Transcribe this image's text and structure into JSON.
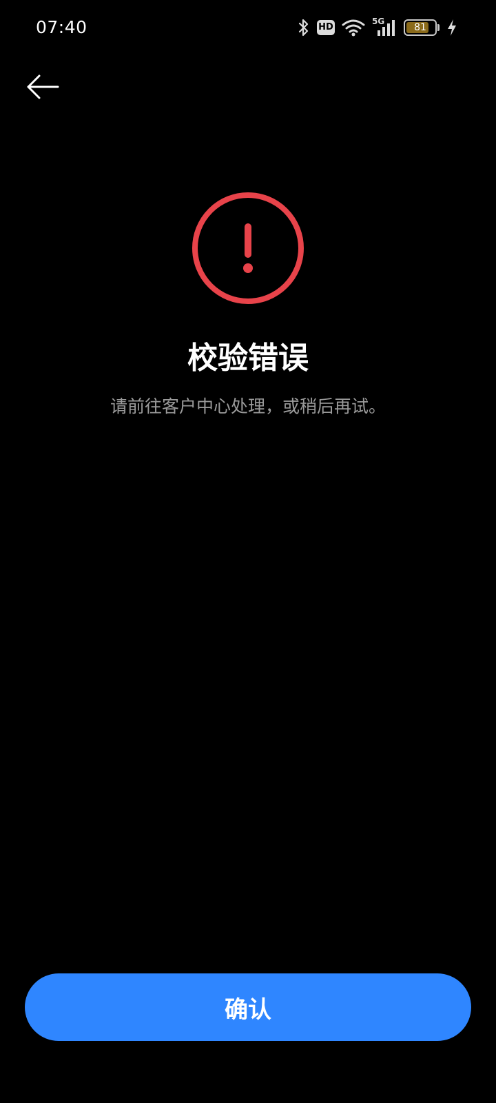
{
  "status_bar": {
    "time": "07:40",
    "network_label": "5G",
    "hd_label": "HD",
    "battery_level": "81",
    "battery_fraction": 0.81,
    "icons": [
      "bluetooth-icon",
      "hd-icon",
      "wifi-icon",
      "cellular-signal-icon",
      "battery-icon",
      "charging-icon"
    ]
  },
  "nav": {
    "back_icon": "arrow-left-icon"
  },
  "error": {
    "icon": "exclamation-circle-icon",
    "icon_color": "#e8434a",
    "title": "校验错误",
    "message": "请前往客户中心处理，或稍后再试。"
  },
  "actions": {
    "confirm_label": "确认",
    "confirm_color": "#2f86ff"
  }
}
